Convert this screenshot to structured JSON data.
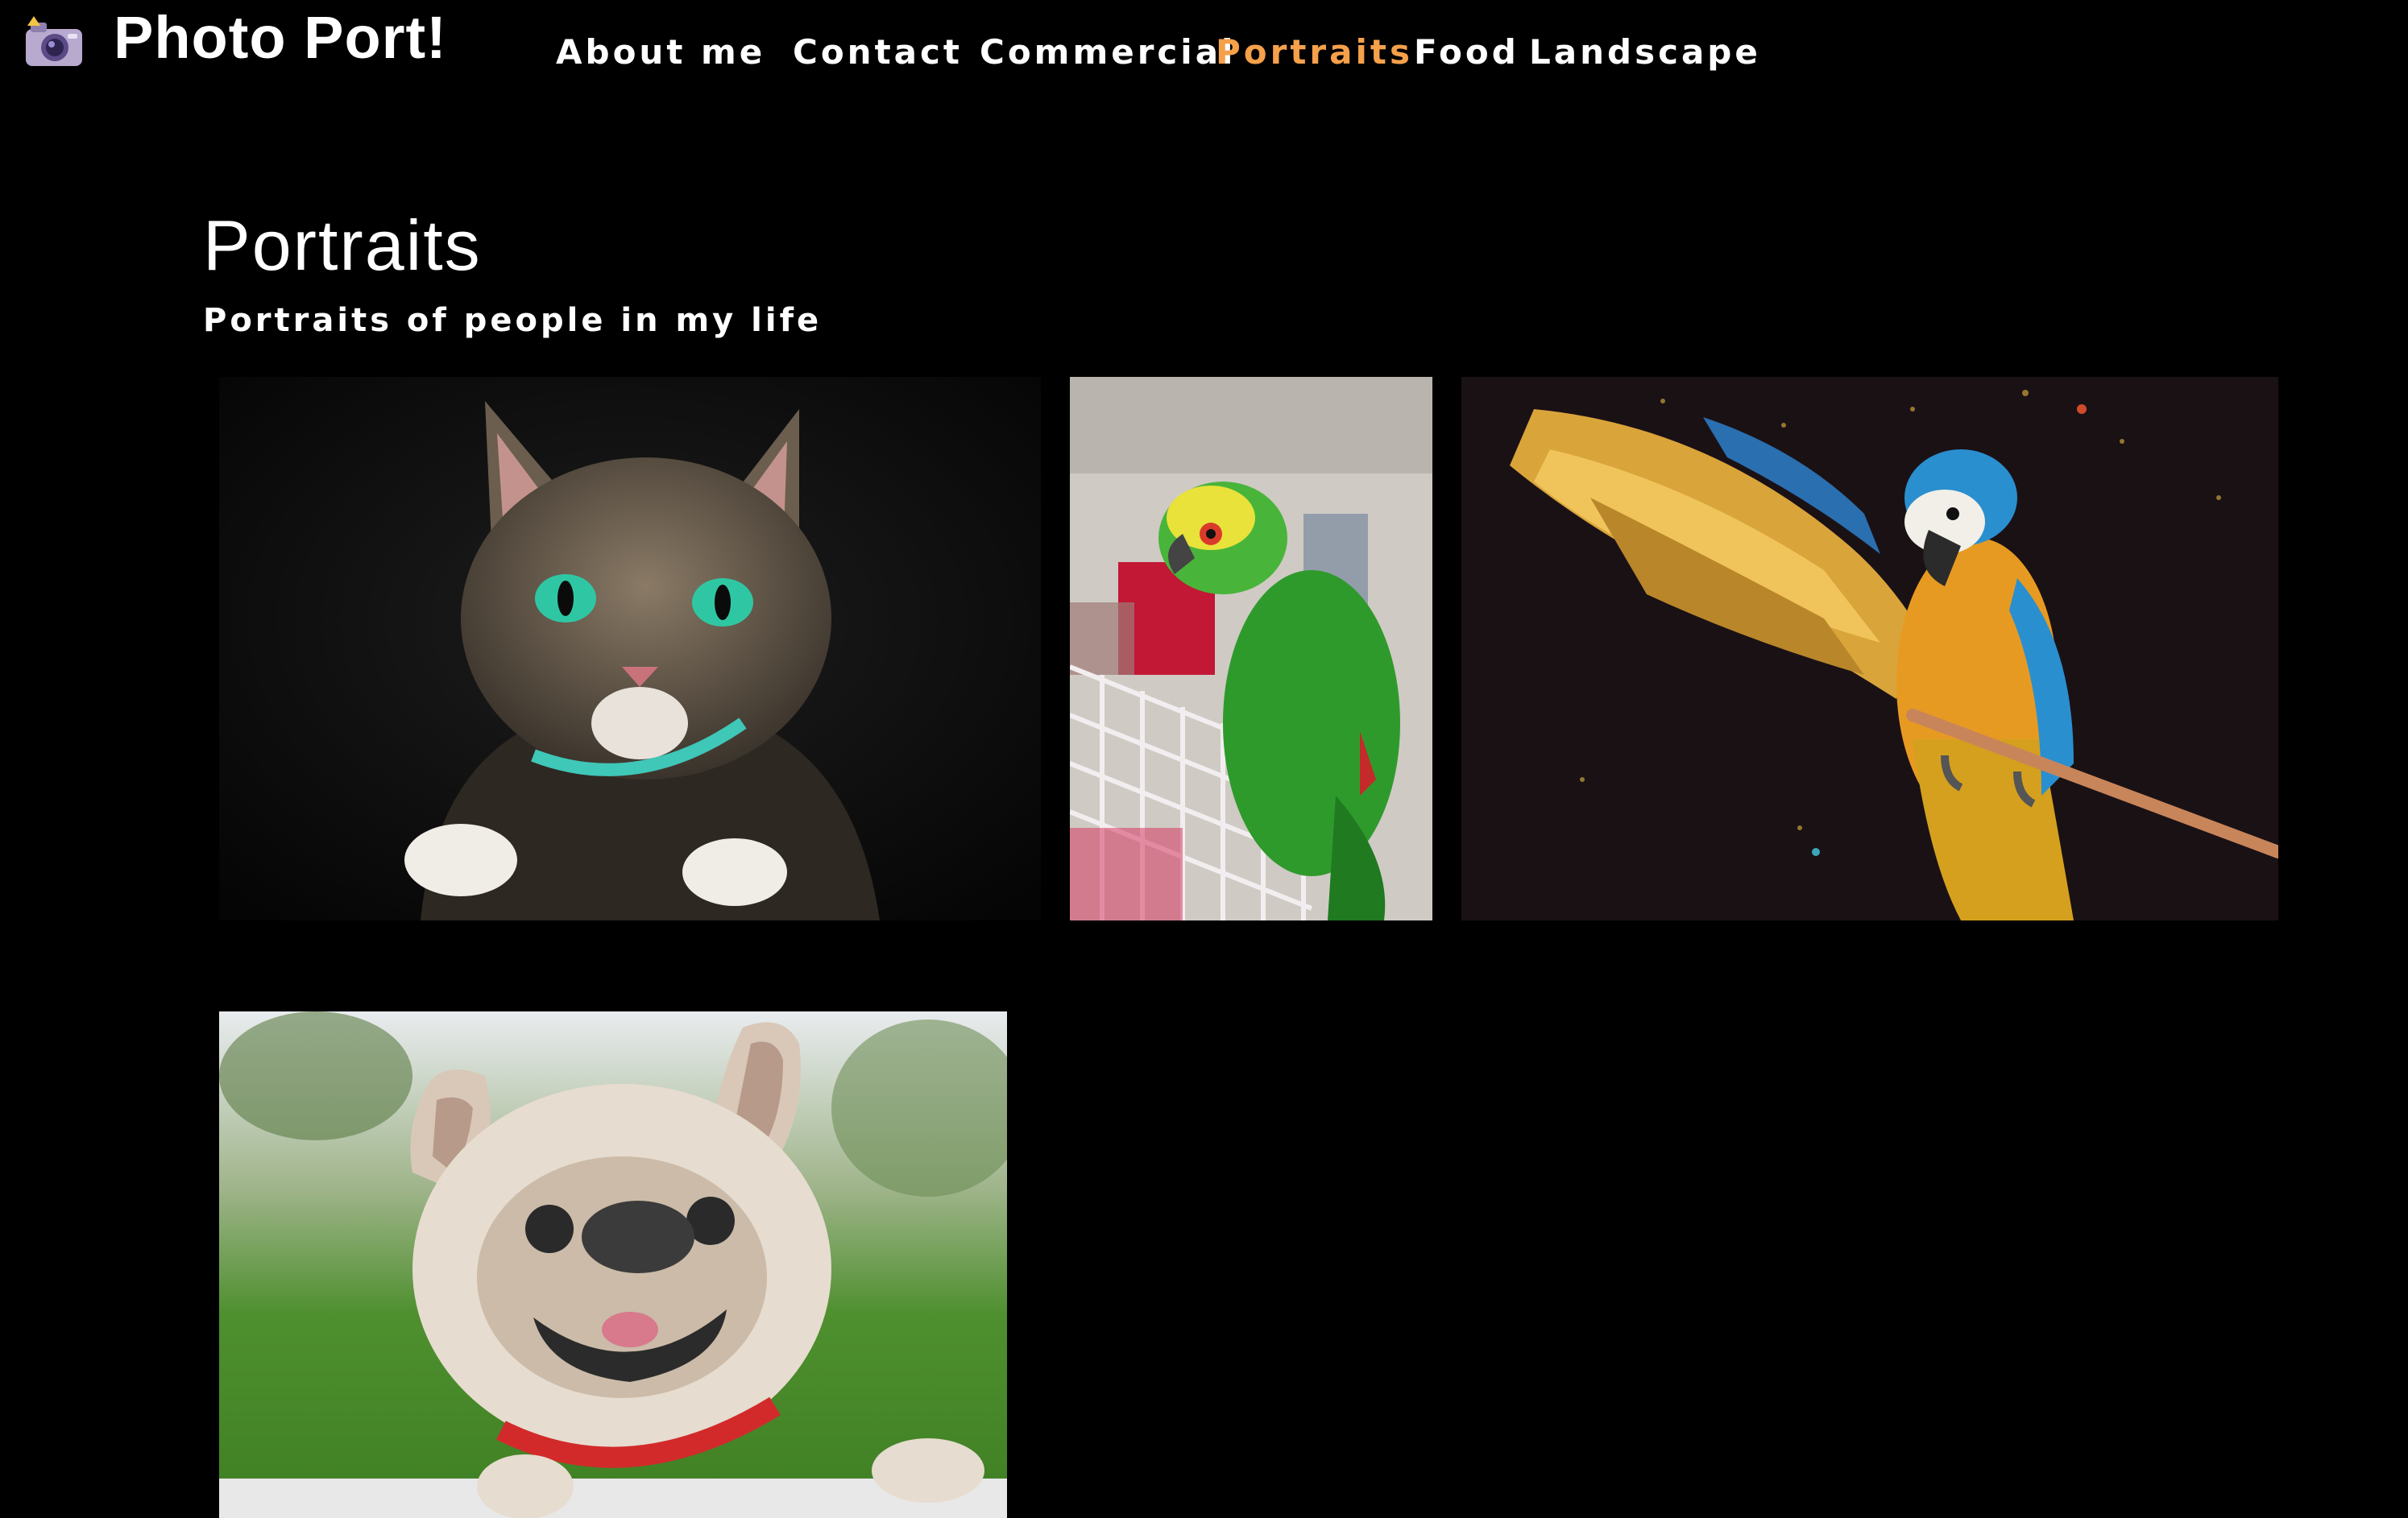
{
  "header": {
    "brand": "Photo Port!",
    "logo_icon": "camera-icon",
    "nav": [
      {
        "label": "About me"
      },
      {
        "label": "Contact"
      },
      {
        "label": "Commercial"
      },
      {
        "label": "Portraits",
        "active": true
      },
      {
        "label": "Food"
      },
      {
        "label": "Landscape"
      }
    ]
  },
  "main": {
    "title": "Portraits",
    "subtitle": "Portraits of people in my life"
  },
  "colors": {
    "background": "#000000",
    "text": "#ffffff",
    "active_nav": "#f5a04a"
  }
}
